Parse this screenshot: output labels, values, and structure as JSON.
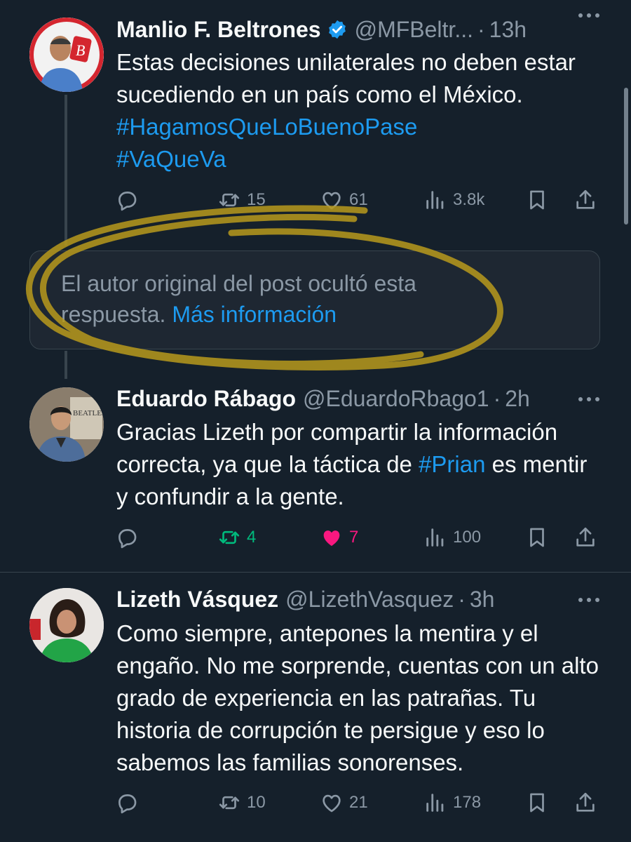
{
  "tweets": [
    {
      "name": "Manlio F. Beltrones",
      "handle": "@MFBeltr...",
      "time": "13h",
      "text_plain": "Estas decisiones unilaterales no deben estar sucediendo en un país como el México. ",
      "hashtag1": "#HagamosQueLoBuenoPase",
      "hashtag2": "#VaQueVa",
      "replies": "",
      "retweets": "15",
      "likes": "61",
      "views": "3.8k"
    },
    {
      "name": "Eduardo Rábago",
      "handle": "@EduardoRbago1",
      "time": "2h",
      "text_pre": "Gracias Lizeth por compartir la información correcta, ya que la táctica de ",
      "hashtag": "#Prian",
      "text_post": " es mentir y confundir a la gente.",
      "replies": "",
      "retweets": "4",
      "likes": "7",
      "views": "100"
    },
    {
      "name": "Lizeth Vásquez",
      "handle": "@LizethVasquez",
      "time": "3h",
      "text": "Como siempre, antepones la mentira y el engaño. No me sorprende, cuentas con un alto grado de experiencia en las patrañas. Tu historia de corrupción te persigue y eso lo sabemos las familias sonorenses.",
      "replies": "",
      "retweets": "10",
      "likes": "21",
      "views": "178"
    }
  ],
  "hidden_reply": {
    "text": "El autor original del post ocultó esta respuesta.",
    "link": "Más información"
  },
  "separator": "·",
  "colors": {
    "background": "#15202b",
    "accent": "#1d9bf0",
    "retweet_active": "#00ba7c",
    "like_active": "#f91880",
    "annotation": "#b89a1c"
  },
  "icons": [
    "verified-badge-icon",
    "more-icon",
    "reply-icon",
    "retweet-icon",
    "like-icon",
    "views-icon",
    "bookmark-icon",
    "share-icon"
  ]
}
